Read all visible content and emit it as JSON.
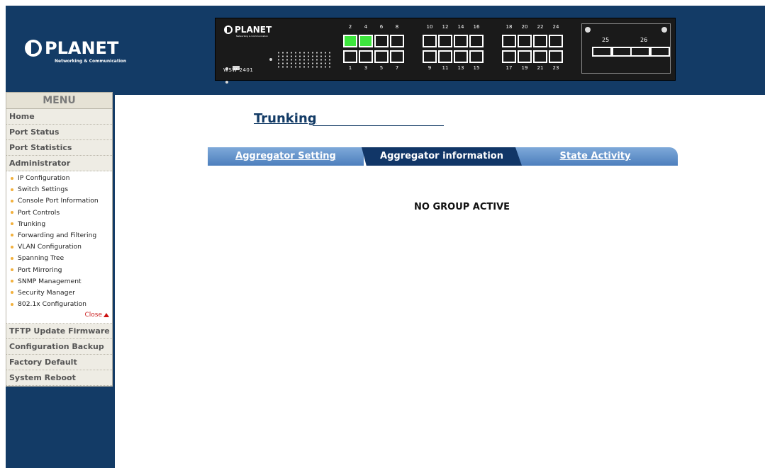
{
  "brand": {
    "name": "PLANET",
    "tagline": "Networking & Communication"
  },
  "device": {
    "brand": "PLANET",
    "tagline": "Networking & Communication",
    "model": "WSW-2401",
    "ports_top": [
      "2",
      "4",
      "6",
      "8",
      "10",
      "12",
      "14",
      "16",
      "18",
      "20",
      "22",
      "24"
    ],
    "ports_bottom": [
      "1",
      "3",
      "5",
      "7",
      "9",
      "11",
      "13",
      "15",
      "17",
      "19",
      "21",
      "23"
    ],
    "active_top_ports": [
      "2",
      "4"
    ],
    "fiber_ports": [
      "25",
      "26"
    ]
  },
  "menu": {
    "title": "MENU",
    "top_items": [
      "Home",
      "Port Status",
      "Port Statistics",
      "Administrator"
    ],
    "admin_sub": [
      "IP Configuration",
      "Switch Settings",
      "Console Port Information",
      "Port Controls",
      "Trunking",
      "Forwarding and Filtering",
      "VLAN Configuration",
      "Spanning Tree",
      "Port Mirroring",
      "SNMP Management",
      "Security Manager",
      "802.1x Configuration"
    ],
    "close_label": "Close",
    "bottom_items": [
      "TFTP Update Firmware",
      "Configuration Backup",
      "Factory Default",
      "System Reboot"
    ]
  },
  "page": {
    "title": "Trunking",
    "tabs": [
      "Aggregator Setting",
      "Aggregator information",
      "State Activity"
    ],
    "active_tab": "Aggregator information",
    "message": "NO GROUP ACTIVE"
  },
  "colors": {
    "frame": "#133b66",
    "active_port": "#3ee63e",
    "tab_active": "#113667",
    "tab_inactive": "#5b8cc6",
    "bullet": "#f2b03c"
  }
}
